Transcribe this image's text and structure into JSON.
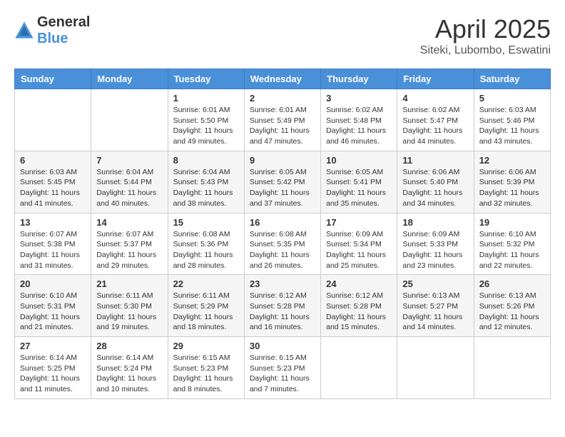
{
  "header": {
    "logo_general": "General",
    "logo_blue": "Blue",
    "title": "April 2025",
    "subtitle": "Siteki, Lubombo, Eswatini"
  },
  "calendar": {
    "days_of_week": [
      "Sunday",
      "Monday",
      "Tuesday",
      "Wednesday",
      "Thursday",
      "Friday",
      "Saturday"
    ],
    "weeks": [
      [
        {
          "day": "",
          "info": ""
        },
        {
          "day": "",
          "info": ""
        },
        {
          "day": "1",
          "info": "Sunrise: 6:01 AM\nSunset: 5:50 PM\nDaylight: 11 hours and 49 minutes."
        },
        {
          "day": "2",
          "info": "Sunrise: 6:01 AM\nSunset: 5:49 PM\nDaylight: 11 hours and 47 minutes."
        },
        {
          "day": "3",
          "info": "Sunrise: 6:02 AM\nSunset: 5:48 PM\nDaylight: 11 hours and 46 minutes."
        },
        {
          "day": "4",
          "info": "Sunrise: 6:02 AM\nSunset: 5:47 PM\nDaylight: 11 hours and 44 minutes."
        },
        {
          "day": "5",
          "info": "Sunrise: 6:03 AM\nSunset: 5:46 PM\nDaylight: 11 hours and 43 minutes."
        }
      ],
      [
        {
          "day": "6",
          "info": "Sunrise: 6:03 AM\nSunset: 5:45 PM\nDaylight: 11 hours and 41 minutes."
        },
        {
          "day": "7",
          "info": "Sunrise: 6:04 AM\nSunset: 5:44 PM\nDaylight: 11 hours and 40 minutes."
        },
        {
          "day": "8",
          "info": "Sunrise: 6:04 AM\nSunset: 5:43 PM\nDaylight: 11 hours and 38 minutes."
        },
        {
          "day": "9",
          "info": "Sunrise: 6:05 AM\nSunset: 5:42 PM\nDaylight: 11 hours and 37 minutes."
        },
        {
          "day": "10",
          "info": "Sunrise: 6:05 AM\nSunset: 5:41 PM\nDaylight: 11 hours and 35 minutes."
        },
        {
          "day": "11",
          "info": "Sunrise: 6:06 AM\nSunset: 5:40 PM\nDaylight: 11 hours and 34 minutes."
        },
        {
          "day": "12",
          "info": "Sunrise: 6:06 AM\nSunset: 5:39 PM\nDaylight: 11 hours and 32 minutes."
        }
      ],
      [
        {
          "day": "13",
          "info": "Sunrise: 6:07 AM\nSunset: 5:38 PM\nDaylight: 11 hours and 31 minutes."
        },
        {
          "day": "14",
          "info": "Sunrise: 6:07 AM\nSunset: 5:37 PM\nDaylight: 11 hours and 29 minutes."
        },
        {
          "day": "15",
          "info": "Sunrise: 6:08 AM\nSunset: 5:36 PM\nDaylight: 11 hours and 28 minutes."
        },
        {
          "day": "16",
          "info": "Sunrise: 6:08 AM\nSunset: 5:35 PM\nDaylight: 11 hours and 26 minutes."
        },
        {
          "day": "17",
          "info": "Sunrise: 6:09 AM\nSunset: 5:34 PM\nDaylight: 11 hours and 25 minutes."
        },
        {
          "day": "18",
          "info": "Sunrise: 6:09 AM\nSunset: 5:33 PM\nDaylight: 11 hours and 23 minutes."
        },
        {
          "day": "19",
          "info": "Sunrise: 6:10 AM\nSunset: 5:32 PM\nDaylight: 11 hours and 22 minutes."
        }
      ],
      [
        {
          "day": "20",
          "info": "Sunrise: 6:10 AM\nSunset: 5:31 PM\nDaylight: 11 hours and 21 minutes."
        },
        {
          "day": "21",
          "info": "Sunrise: 6:11 AM\nSunset: 5:30 PM\nDaylight: 11 hours and 19 minutes."
        },
        {
          "day": "22",
          "info": "Sunrise: 6:11 AM\nSunset: 5:29 PM\nDaylight: 11 hours and 18 minutes."
        },
        {
          "day": "23",
          "info": "Sunrise: 6:12 AM\nSunset: 5:28 PM\nDaylight: 11 hours and 16 minutes."
        },
        {
          "day": "24",
          "info": "Sunrise: 6:12 AM\nSunset: 5:28 PM\nDaylight: 11 hours and 15 minutes."
        },
        {
          "day": "25",
          "info": "Sunrise: 6:13 AM\nSunset: 5:27 PM\nDaylight: 11 hours and 14 minutes."
        },
        {
          "day": "26",
          "info": "Sunrise: 6:13 AM\nSunset: 5:26 PM\nDaylight: 11 hours and 12 minutes."
        }
      ],
      [
        {
          "day": "27",
          "info": "Sunrise: 6:14 AM\nSunset: 5:25 PM\nDaylight: 11 hours and 11 minutes."
        },
        {
          "day": "28",
          "info": "Sunrise: 6:14 AM\nSunset: 5:24 PM\nDaylight: 11 hours and 10 minutes."
        },
        {
          "day": "29",
          "info": "Sunrise: 6:15 AM\nSunset: 5:23 PM\nDaylight: 11 hours and 8 minutes."
        },
        {
          "day": "30",
          "info": "Sunrise: 6:15 AM\nSunset: 5:23 PM\nDaylight: 11 hours and 7 minutes."
        },
        {
          "day": "",
          "info": ""
        },
        {
          "day": "",
          "info": ""
        },
        {
          "day": "",
          "info": ""
        }
      ]
    ]
  }
}
